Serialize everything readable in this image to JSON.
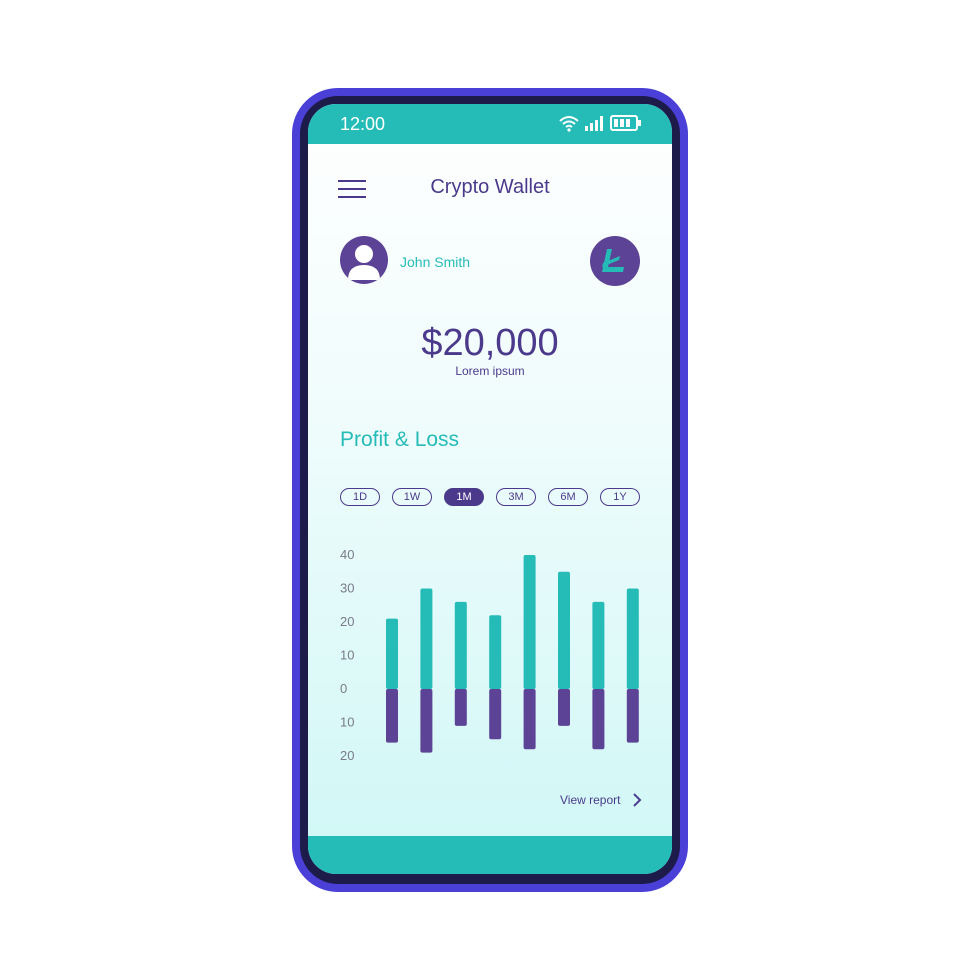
{
  "status_bar": {
    "time": "12:00",
    "icons": [
      "wifi-icon",
      "signal-icon",
      "battery-icon"
    ]
  },
  "header": {
    "menu_icon": "hamburger-icon",
    "title": "Crypto Wallet"
  },
  "profile": {
    "name": "John Smith",
    "avatar_icon": "user-icon",
    "coin_icon": "litecoin-icon"
  },
  "balance": {
    "amount": "$20,000",
    "caption": "Lorem ipsum"
  },
  "section": {
    "title": "Profit & Loss"
  },
  "ranges": [
    {
      "label": "1D",
      "active": false
    },
    {
      "label": "1W",
      "active": false
    },
    {
      "label": "1M",
      "active": true
    },
    {
      "label": "3M",
      "active": false
    },
    {
      "label": "6M",
      "active": false
    },
    {
      "label": "1Y",
      "active": false
    }
  ],
  "chart_data": {
    "type": "bar",
    "y_ticks": [
      "40",
      "30",
      "20",
      "10",
      "0",
      "10",
      "20"
    ],
    "ylim": [
      -20,
      40
    ],
    "series": [
      {
        "values": [
          21,
          30,
          26,
          22,
          40,
          35,
          26,
          30
        ],
        "color": "#25bcb8"
      },
      {
        "values": [
          -16,
          -19,
          -11,
          -15,
          -18,
          -11,
          -18,
          -16
        ],
        "color": "#5c4396"
      }
    ]
  },
  "footer": {
    "view_report": "View report",
    "arrow_icon": "chevron-right-icon"
  },
  "colors": {
    "frame": "#4a3fd6",
    "accent": "#25bcb8",
    "primary": "#4b3a8c",
    "bar_negative": "#5c4396"
  }
}
